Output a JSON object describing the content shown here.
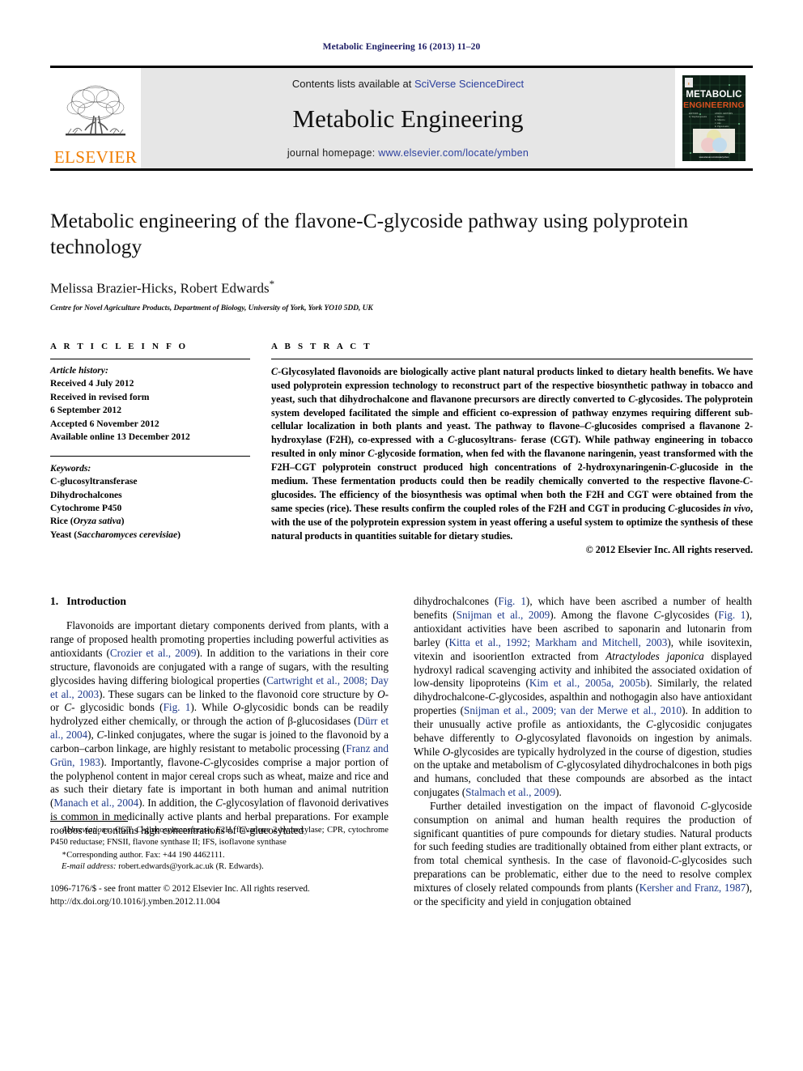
{
  "running_head": "Metabolic Engineering 16 (2013) 11–20",
  "masthead": {
    "contents_prefix": "Contents lists available at ",
    "contents_link": "SciVerse ScienceDirect",
    "journal_title": "Metabolic Engineering",
    "homepage_prefix": "journal homepage: ",
    "homepage_link": "www.elsevier.com/locate/ymben",
    "publisher_wordmark": "ELSEVIER",
    "cover_title_line1": "METABOLIC",
    "cover_title_line2": "ENGINEERING",
    "accent_orange": "#f07d00",
    "link_blue": "#2b3f9e",
    "running_head_color": "#1b1b63"
  },
  "article": {
    "title": "Metabolic engineering of the flavone-C-glycoside pathway using polyprotein technology",
    "authors": "Melissa Brazier-Hicks, Robert Edwards",
    "corresponding_marker": "*",
    "affiliation": "Centre for Novel Agriculture Products, Department of Biology, University of York, York YO10 5DD, UK"
  },
  "article_info": {
    "heading": "A R T I C L E   I N F O",
    "history_label": "Article history:",
    "history": [
      "Received 4 July 2012",
      "Received in revised form",
      "6 September 2012",
      "Accepted 6 November 2012",
      "Available online 13 December 2012"
    ],
    "keywords_label": "Keywords:",
    "keywords": [
      "C-glucosyltransferase",
      "Dihydrochalcones",
      "Cytochrome P450",
      "Rice (Oryza sativa)",
      "Yeast (Saccharomyces cerevisiae)"
    ],
    "keyword_italics": {
      "rice": "Oryza sativa",
      "yeast": "Saccharomyces cerevisiae"
    }
  },
  "abstract": {
    "heading": "A B S T R A C T",
    "text": "C-Glycosylated flavonoids are biologically active plant natural products linked to dietary health benefits. We have used polyprotein expression technology to reconstruct part of the respective biosynthetic pathway in tobacco and yeast, such that dihydrochalcone and flavanone precursors are directly converted to C-glycosides. The polyprotein system developed facilitated the simple and efficient co-expression of pathway enzymes requiring different sub-cellular localization in both plants and yeast. The pathway to flavone-C-glucosides comprised a flavanone 2-hydroxylase (F2H), co-expressed with a C-glucosyltransferase (CGT). While pathway engineering in tobacco resulted in only minor C-glycoside formation, when fed with the flavanone naringenin, yeast transformed with the F2H-CGT polyprotein construct produced high concentrations of 2-hydroxynaringenin-C-glucoside in the medium. These fermentation products could then be readily chemically converted to the respective flavone-C-glucosides. The efficiency of the biosynthesis was optimal when both the F2H and CGT were obtained from the same species (rice). These results confirm the coupled roles of the F2H and CGT in producing C-glucosides in vivo, with the use of the polyprotein expression system in yeast offering a useful system to optimize the synthesis of these natural products in quantities suitable for dietary studies.",
    "copyright": "© 2012 Elsevier Inc. All rights reserved."
  },
  "introduction": {
    "heading_number": "1.",
    "heading_text": "Introduction",
    "left_paragraph_1": "Flavonoids are important dietary components derived from plants, with a range of proposed health promoting properties including powerful activities as antioxidants (Crozier et al., 2009). In addition to the variations in their core structure, flavonoids are conjugated with a range of sugars, with the resulting glycosides having differing biological properties (Cartwright et al., 2008; Day et al., 2003). These sugars can be linked to the flavonoid core structure by O- or C- glycosidic bonds (Fig. 1). While O-glycosidic bonds can be readily hydrolyzed either chemically, or through the action of β-glucosidases (Dürr et al., 2004), C-linked conjugates, where the sugar is joined to the flavonoid by a carbon–carbon linkage, are highly resistant to metabolic processing (Franz and Grün, 1983). Importantly, flavone-C-glycosides comprise a major portion of the polyphenol content in major cereal crops such as wheat, maize and rice and as such their dietary fate is important in both human and animal nutrition (Manach et al., 2004). In addition, the C-glycosylation of flavonoid derivatives is common in medicinally active plants and herbal preparations. For example rooibos tea, contains high concentrations of C-glucosylated",
    "right_paragraph_1": "dihydrochalcones (Fig. 1), which have been ascribed a number of health benefits (Snijman et al., 2009). Among the flavone C-glycosides (Fig. 1), antioxidant activities have been ascribed to saponarin and lutonarin from barley (Kitta et al., 1992; Markham and Mitchell, 2003), while isovitexin, vitexin and isoorientION extracted from Atractylodes japonica displayed hydroxyl radical scavenging activity and inhibited the associated oxidation of low-density lipoproteins (Kim et al., 2005a, 2005b). Similarly, the related dihydrochalcone-C-glycosides, aspalthin and nothogagin also have antioxidant properties (Snijman et al., 2009; van der Merwe et al., 2010). In addition to their unusually active profile as antioxidants, the C-glycosidic conjugates behave differently to O-glycosylated flavonoids on ingestion by animals. While O-glycosides are typically hydrolyzed in the course of digestion, studies on the uptake and metabolism of C-glycosylated dihydrochalcones in both pigs and humans, concluded that these compounds are absorbed as the intact conjugates (Stalmach et al., 2009).",
    "right_paragraph_2": "Further detailed investigation on the impact of flavonoid C-glycoside consumption on animal and human health requires the production of significant quantities of pure compounds for dietary studies. Natural products for such feeding studies are traditionally obtained from either plant extracts, or from total chemical synthesis. In the case of flavonoid-C-glycosides such preparations can be problematic, either due to the need to resolve complex mixtures of closely related compounds from plants (Kersher and Franz, 1987), or the specificity and yield in conjugation obtained"
  },
  "footnotes": {
    "abbreviations_label": "Abbreviations:",
    "abbreviations_text": " CGT, C-glucosyltransferase; F2H, flavanone 2-hydroxylase; CPR, cytochrome P450 reductase; FNSII, flavone synthase II; IFS, isoflavone synthase",
    "corresponding": "Corresponding author. Fax: +44 190 4462111.",
    "email_label": "E-mail address:",
    "email_value": " robert.edwards@york.ac.uk (R. Edwards).",
    "imprint_line1": "1096-7176/$ - see front matter © 2012 Elsevier Inc. All rights reserved.",
    "imprint_line2": "http://dx.doi.org/10.1016/j.ymben.2012.11.004"
  }
}
